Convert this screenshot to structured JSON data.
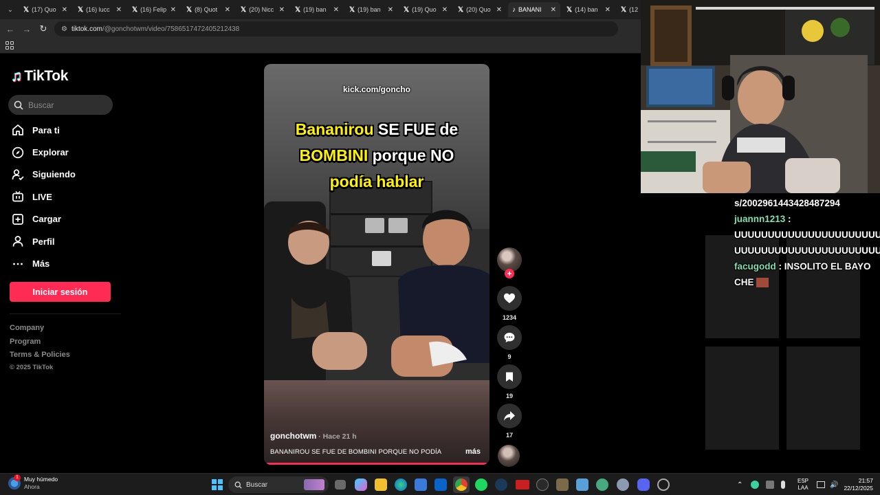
{
  "browser": {
    "tabs": [
      {
        "label": "(17) Quo",
        "active": false
      },
      {
        "label": "(16) lucc",
        "active": false
      },
      {
        "label": "(16) Felip",
        "active": false
      },
      {
        "label": "(8) Quot",
        "active": false
      },
      {
        "label": "(20) Nicc",
        "active": false
      },
      {
        "label": "(19) ban",
        "active": false
      },
      {
        "label": "(19) ban",
        "active": false
      },
      {
        "label": "(19) Quo",
        "active": false
      },
      {
        "label": "(20) Quo",
        "active": false
      },
      {
        "label": "BANANI",
        "active": true
      },
      {
        "label": "(14) ban",
        "active": false
      },
      {
        "label": "(12",
        "active": false
      }
    ],
    "url_domain": "tiktok.com",
    "url_path": "/@gonchotwm/video/7586517472405212438"
  },
  "tiktok": {
    "brand": "TikTok",
    "search_placeholder": "Buscar",
    "nav": [
      {
        "label": "Para ti",
        "icon": "home-icon"
      },
      {
        "label": "Explorar",
        "icon": "compass-icon"
      },
      {
        "label": "Siguiendo",
        "icon": "following-icon"
      },
      {
        "label": "LIVE",
        "icon": "live-icon"
      },
      {
        "label": "Cargar",
        "icon": "upload-icon"
      },
      {
        "label": "Perfil",
        "icon": "profile-icon"
      },
      {
        "label": "Más",
        "icon": "more-icon"
      }
    ],
    "login_label": "Iniciar sesión",
    "footer_links": [
      "Company",
      "Program",
      "Terms & Policies"
    ],
    "copyright": "© 2025 TikTok"
  },
  "video": {
    "watermark": "kick.com/goncho",
    "headline": {
      "line1_yellow": "Bananirou",
      "line1_white": " SE FUE de",
      "line2_yellow": "BOMBINI",
      "line2_white": " porque NO",
      "line3_yellow": "podía hablar"
    },
    "author": "gonchotwm",
    "time": " · Hace 21 h",
    "caption": "BANANIROU SE FUE DE BOMBINI PORQUE NO PODÍA",
    "more": "más",
    "likes": "1234",
    "comments": "9",
    "saves": "19",
    "shares": "17",
    "follow_plus": "+"
  },
  "stream_chat": [
    {
      "user": "",
      "text": "s/2002961443428487294"
    },
    {
      "user": "juannn1213",
      "text": " :"
    },
    {
      "user": "",
      "text": "UUUUUUUUUUUUUUUUUUUUUU"
    },
    {
      "user": "",
      "text": "UUUUUUUUUUUUUUUUUUUUUU"
    },
    {
      "user": "facugodd",
      "text": " : INSOLITO EL BAYO"
    },
    {
      "user": "",
      "text": "CHE"
    }
  ],
  "taskbar": {
    "weather_title": "Muy húmedo",
    "weather_sub": "Ahora",
    "weather_badge": "1",
    "search_label": "Buscar",
    "lang_top": "ESP",
    "lang_bottom": "LAA",
    "time": "21:57",
    "date": "22/12/2025"
  },
  "colors": {
    "accent": "#fe2c55",
    "headline_yellow": "#fff200",
    "chat_user": "#7fe0b0"
  }
}
